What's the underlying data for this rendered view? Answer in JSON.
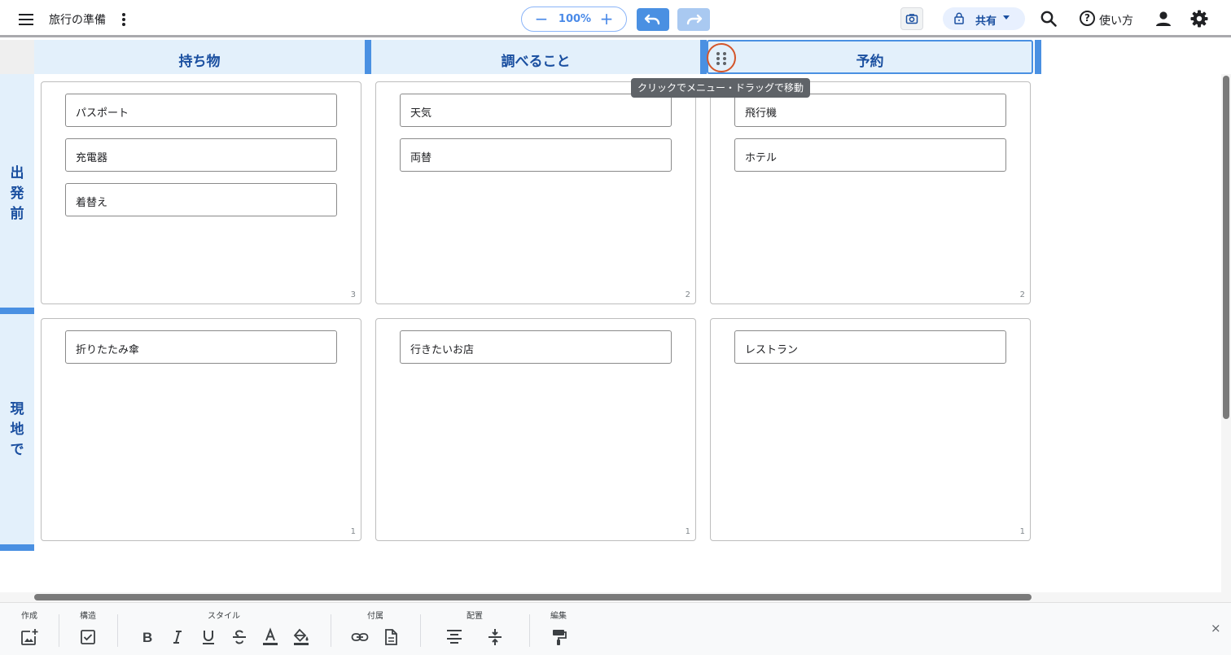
{
  "app": {
    "title": "旅行の準備",
    "zoom_value": "100%",
    "share_label": "共有",
    "help_label": "使い方",
    "accent_color": "#4a90e2",
    "header_text_color": "#1a4fa0",
    "header_bg_color": "#e3f0fb"
  },
  "grid": {
    "columns": [
      {
        "label": "持ち物"
      },
      {
        "label": "調べること"
      },
      {
        "label": "予約"
      }
    ],
    "rows": [
      {
        "label": "出発前"
      },
      {
        "label": "現地で"
      }
    ],
    "cells": [
      [
        {
          "count": "3",
          "cards": [
            "パスポート",
            "充電器",
            "着替え"
          ]
        },
        {
          "count": "2",
          "cards": [
            "天気",
            "両替"
          ]
        },
        {
          "count": "2",
          "cards": [
            "飛行機",
            "ホテル"
          ]
        }
      ],
      [
        {
          "count": "1",
          "cards": [
            "折りたたみ傘"
          ]
        },
        {
          "count": "1",
          "cards": [
            "行きたいお店"
          ]
        },
        {
          "count": "1",
          "cards": [
            "レストラン"
          ]
        }
      ]
    ],
    "selected_column": 2
  },
  "tooltip": "クリックでメニュー・ドラッグで移動",
  "toolbar": {
    "groups": {
      "create": "作成",
      "structure": "構造",
      "style": "スタイル",
      "attach": "付属",
      "layout": "配置",
      "edit": "編集"
    },
    "close": "×",
    "icons": [
      "add-card-icon",
      "checkbox-icon",
      "bold-icon",
      "italic-icon",
      "underline-icon",
      "strikethrough-icon",
      "text-color-icon",
      "fill-color-icon",
      "link-icon",
      "document-icon",
      "align-center-icon",
      "vertical-spacing-icon",
      "format-paint-icon"
    ]
  }
}
